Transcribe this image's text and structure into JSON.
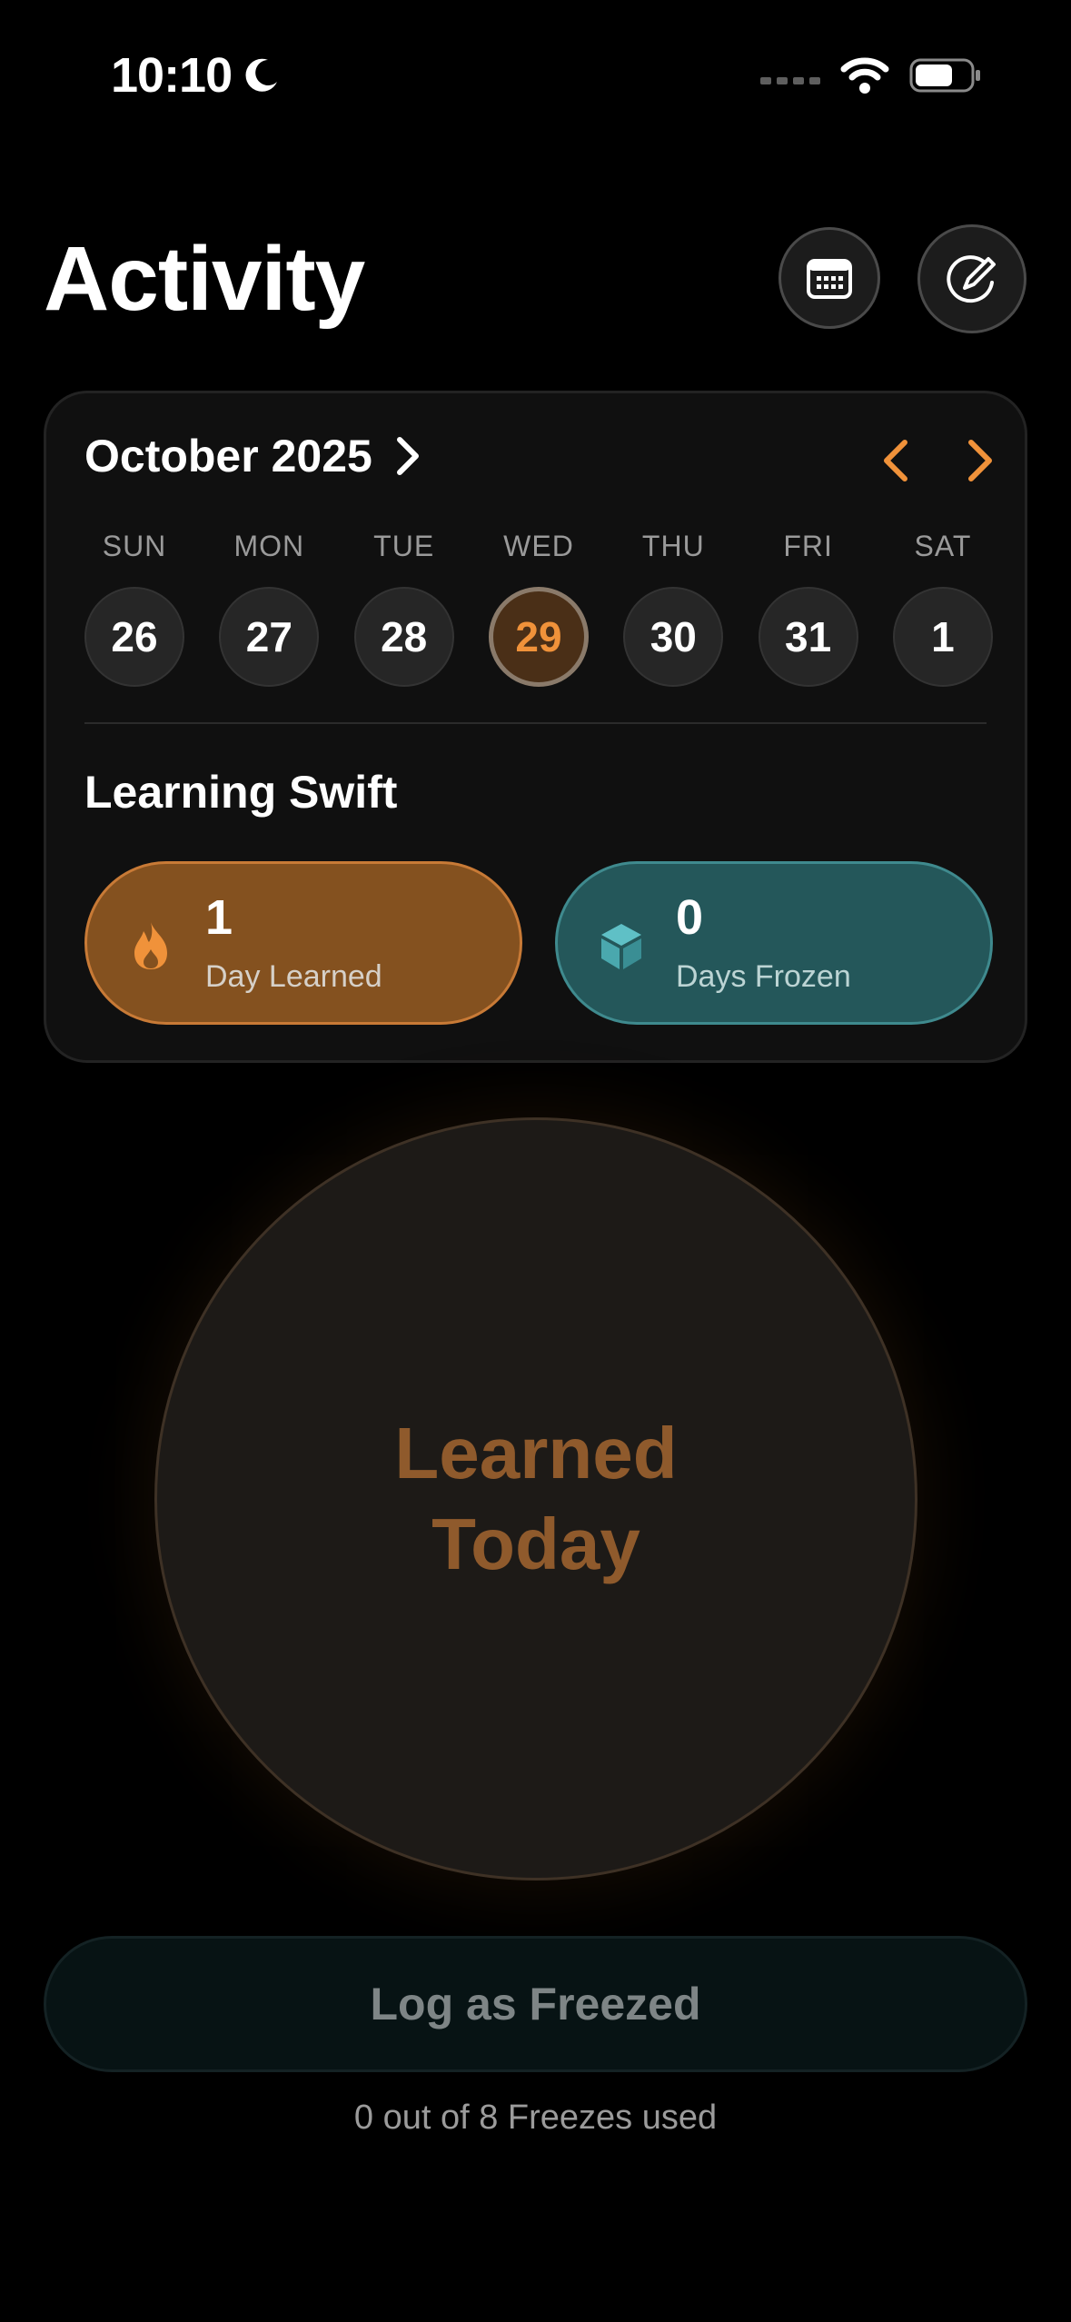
{
  "status_bar": {
    "time": "10:10"
  },
  "header": {
    "title": "Activity"
  },
  "calendar": {
    "month_label": "October 2025",
    "weekdays": [
      "SUN",
      "MON",
      "TUE",
      "WED",
      "THU",
      "FRI",
      "SAT"
    ],
    "days": [
      "26",
      "27",
      "28",
      "29",
      "30",
      "31",
      "1"
    ],
    "selected_day": "29"
  },
  "goal": {
    "title": "Learning Swift",
    "learned": {
      "count": "1",
      "label": "Day Learned"
    },
    "frozen": {
      "count": "0",
      "label": "Days Frozen"
    }
  },
  "main_button": {
    "label": "Learned Today"
  },
  "freeze": {
    "button_label": "Log as Freezed",
    "usage_text": "0 out of 8 Freezes used"
  },
  "colors": {
    "accent_orange": "#f0923a",
    "learned_pill": "#84511f",
    "frozen_pill": "#24575a",
    "background": "#000000"
  }
}
